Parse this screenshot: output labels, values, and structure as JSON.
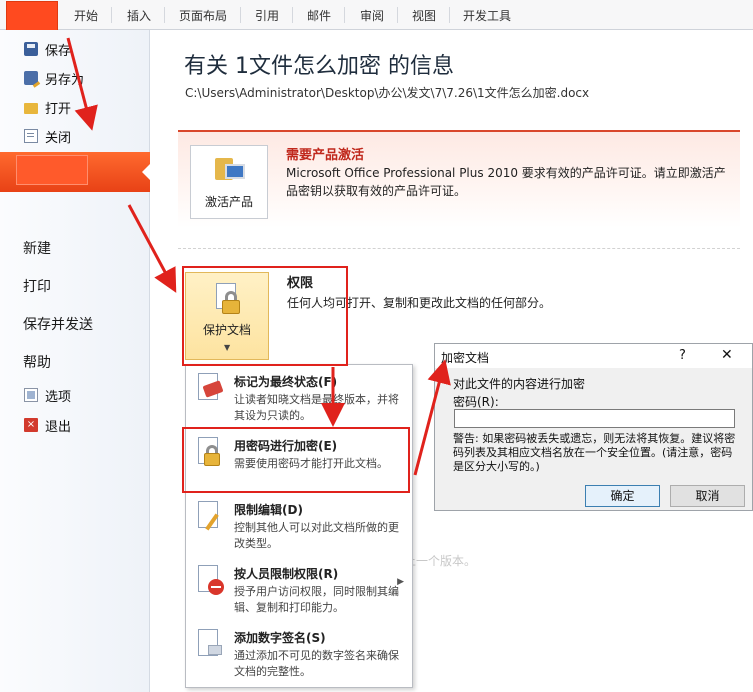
{
  "ribbon": {
    "tabs": [
      "开始",
      "插入",
      "页面布局",
      "引用",
      "邮件",
      "审阅",
      "视图",
      "开发工具"
    ]
  },
  "backstage": {
    "small_items": [
      {
        "label": "保存",
        "icon": "save-icon"
      },
      {
        "label": "另存为",
        "icon": "save-as-icon"
      },
      {
        "label": "打开",
        "icon": "open-folder-icon"
      },
      {
        "label": "关闭",
        "icon": "close-doc-icon"
      }
    ],
    "big_items": [
      "新建",
      "打印",
      "保存并发送",
      "帮助"
    ],
    "bottom_items": [
      {
        "label": "选项",
        "icon": "options-icon"
      },
      {
        "label": "退出",
        "icon": "exit-icon"
      }
    ]
  },
  "info": {
    "title": "有关 1文件怎么加密 的信息",
    "path": "C:\\Users\\Administrator\\Desktop\\办公\\发文\\7\\7.26\\1文件怎么加密.docx",
    "activation": {
      "button_label": "激活产品",
      "heading": "需要产品激活",
      "description": "Microsoft Office Professional Plus 2010 要求有效的产品许可证。请立即激活产品密钥以获取有效的产品许可证。"
    },
    "permissions": {
      "button_label": "保护文档",
      "heading": "权限",
      "description": "任何人均可打开、复制和更改此文档的任何部分。"
    },
    "faded_text": "，打不到此文件的上一个版本。"
  },
  "protect_menu": {
    "items": [
      {
        "title": "标记为最终状态(F)",
        "desc": "让读者知晓文档是最终版本，并将其设为只读的。",
        "icon": "mark-final-icon",
        "has_submenu": false
      },
      {
        "title": "用密码进行加密(E)",
        "desc": "需要使用密码才能打开此文档。",
        "icon": "encrypt-lock-icon",
        "has_submenu": false
      },
      {
        "title": "限制编辑(D)",
        "desc": "控制其他人可以对此文档所做的更改类型。",
        "icon": "restrict-editing-icon",
        "has_submenu": false
      },
      {
        "title": "按人员限制权限(R)",
        "desc": "授予用户访问权限，同时限制其编辑、复制和打印能力。",
        "icon": "restrict-permission-icon",
        "has_submenu": true
      },
      {
        "title": "添加数字签名(S)",
        "desc": "通过添加不可见的数字签名来确保文档的完整性。",
        "icon": "digital-signature-icon",
        "has_submenu": false
      }
    ]
  },
  "encrypt_dialog": {
    "title": "加密文档",
    "help": "?",
    "close": "✕",
    "prompt": "对此文件的内容进行加密",
    "password_label": "密码(R):",
    "password_value": "",
    "warning": "警告: 如果密码被丢失或遗忘，则无法将其恢复。建议将密码列表及其相应文档名放在一个安全位置。(请注意，密码是区分大小写的。)",
    "ok": "确定",
    "cancel": "取消"
  },
  "colors": {
    "file_tab": "#ff4a1f",
    "annotation_red": "#e0221c",
    "activation_heading": "#c0281c",
    "selected_highlight": "#fde3a0"
  }
}
